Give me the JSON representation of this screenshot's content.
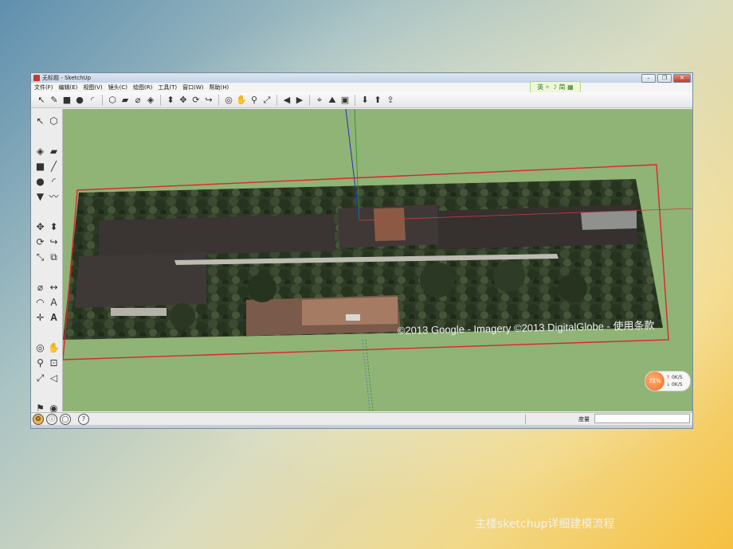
{
  "window": {
    "title": "无标题 - SketchUp",
    "controls": {
      "minimize": "–",
      "maximize": "❐",
      "close": "✕"
    }
  },
  "menu": [
    "文件(F)",
    "编辑(E)",
    "视图(V)",
    "镜头(C)",
    "绘图(R)",
    "工具(T)",
    "窗口(W)",
    "帮助(H)"
  ],
  "ime_badge": "英 ⸰ ☽ 简 ▦",
  "toolbar_icons": [
    "select-icon",
    "pencil-icon",
    "rectangle-icon",
    "circle-icon",
    "arc-icon",
    "sep",
    "make-component-icon",
    "eraser-icon",
    "tape-measure-icon",
    "paint-bucket-icon",
    "sep",
    "push-pull-icon",
    "move-icon",
    "rotate-icon",
    "follow-me-icon",
    "sep",
    "orbit-icon",
    "pan-icon",
    "zoom-icon",
    "zoom-extents-icon",
    "sep",
    "previous-view-icon",
    "next-view-icon",
    "sep",
    "add-location-icon",
    "toggle-terrain-icon",
    "photo-textures-icon",
    "sep",
    "get-models-icon",
    "share-model-icon",
    "share-component-icon"
  ],
  "left_tools": [
    "select-icon",
    "make-component-icon",
    "paint-bucket-icon",
    "eraser-icon",
    "rectangle-icon",
    "line-icon",
    "circle-icon",
    "arc-icon",
    "polygon-icon",
    "freehand-icon",
    "move-icon",
    "push-pull-icon",
    "rotate-icon",
    "follow-me-icon",
    "scale-icon",
    "offset-icon",
    "tape-measure-icon",
    "dimension-icon",
    "protractor-icon",
    "text-icon",
    "axes-icon",
    "3d-text-icon",
    "orbit-icon",
    "pan-icon",
    "zoom-icon",
    "zoom-window-icon",
    "zoom-extents-icon",
    "previous-icon",
    "position-camera-icon",
    "look-around-icon",
    "walk-icon",
    "section-plane-icon"
  ],
  "imagery_credit": "©2013 Google - Imagery ©2013 DigitalGlobe - 使用条款",
  "status": {
    "measure_label": "度量",
    "measure_value": ""
  },
  "net_widget": {
    "percent": "71%",
    "up_label": "0K/S",
    "down_label": "0K/S"
  },
  "caption": "主楼sketchup详细建模流程",
  "colors": {
    "ground": "#8fb476",
    "selection_red": "#e0242a",
    "axis_blue": "#2030c8",
    "axis_green": "#2a8a2a"
  }
}
